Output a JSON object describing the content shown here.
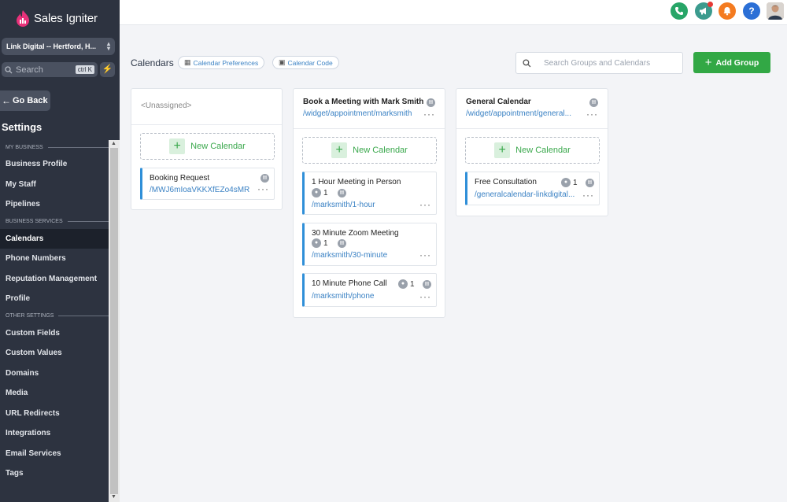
{
  "sidebar": {
    "brand": "Sales Igniter",
    "location": "Link Digital -- Hertford, H...",
    "search_label": "Search",
    "search_shortcut": "ctrl K",
    "go_back": "Go Back",
    "settings_title": "Settings",
    "sections": {
      "my_business": "MY BUSINESS",
      "business_services": "BUSINESS SERVICES",
      "other_settings": "OTHER SETTINGS"
    },
    "items": {
      "business_profile": "Business Profile",
      "my_staff": "My Staff",
      "pipelines": "Pipelines",
      "calendars": "Calendars",
      "phone_numbers": "Phone Numbers",
      "reputation_management": "Reputation Management",
      "profile": "Profile",
      "custom_fields": "Custom Fields",
      "custom_values": "Custom Values",
      "domains": "Domains",
      "media": "Media",
      "url_redirects": "URL Redirects",
      "integrations": "Integrations",
      "email_services": "Email Services",
      "tags": "Tags"
    }
  },
  "topbar": {
    "colors": {
      "phone": "#27a567",
      "megaphone": "#3b9b8e",
      "bell": "#f47b20",
      "help": "#2b6fd6"
    },
    "help_label": "?"
  },
  "header": {
    "title": "Calendars",
    "calendar_preferences": "Calendar Preferences",
    "calendar_code": "Calendar Code",
    "search_placeholder": "Search Groups and Calendars",
    "add_group": "Add Group"
  },
  "groups": [
    {
      "title": "<Unassigned>",
      "new_calendar": "New Calendar",
      "calendars": [
        {
          "title": "Booking Request",
          "link": "/MWJ6mIoaVKKXfEZo4sMR"
        }
      ]
    },
    {
      "title": "Book a Meeting with Mark Smith",
      "link": "/widget/appointment/marksmith",
      "new_calendar": "New Calendar",
      "calendars": [
        {
          "title": "1 Hour Meeting in Person",
          "count": "1",
          "link": "/marksmith/1-hour"
        },
        {
          "title": "30 Minute Zoom Meeting",
          "count": "1",
          "link": "/marksmith/30-minute"
        },
        {
          "title": "10 Minute Phone Call",
          "count": "1",
          "link": "/marksmith/phone"
        }
      ]
    },
    {
      "title": "General Calendar",
      "link": "/widget/appointment/general...",
      "new_calendar": "New Calendar",
      "calendars": [
        {
          "title": "Free Consultation",
          "count": "1",
          "link": "/generalcalendar-linkdigital..."
        }
      ]
    }
  ]
}
